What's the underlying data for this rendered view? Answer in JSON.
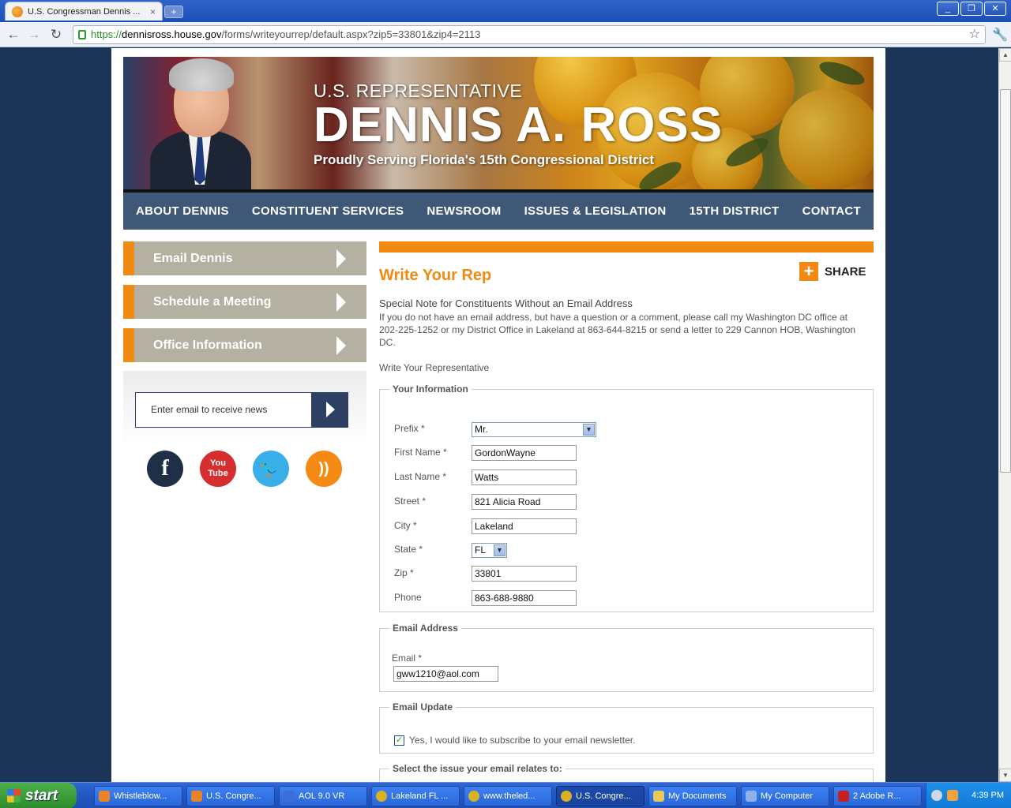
{
  "browser": {
    "tab_title": "U.S. Congressman Dennis ...",
    "tab_close": "×",
    "new_tab": "+",
    "url_scheme": "https://",
    "url_host": "dennisross.house.gov",
    "url_path": "/forms/writeyourrep/default.aspx?zip5=33801&zip4=2113"
  },
  "banner": {
    "pre_title": "U.S. REPRESENTATIVE",
    "name": "DENNIS A. ROSS",
    "subtitle": "Proudly Serving Florida's 15th Congressional District"
  },
  "nav": {
    "items": [
      "ABOUT DENNIS",
      "CONSTITUENT SERVICES",
      "NEWSROOM",
      "ISSUES & LEGISLATION",
      "15TH DISTRICT",
      "CONTACT"
    ]
  },
  "sidebar": {
    "buttons": [
      "Email Dennis",
      "Schedule a Meeting",
      "Office Information"
    ],
    "news_placeholder": "Enter email to receive news",
    "social": [
      {
        "name": "facebook-icon",
        "glyph": "f",
        "color": "#1f2f47"
      },
      {
        "name": "youtube-icon",
        "glyph": "You Tube",
        "color": "#d62e2e"
      },
      {
        "name": "twitter-icon",
        "glyph": "t",
        "color": "#3aaee8"
      },
      {
        "name": "rss-icon",
        "glyph": "))",
        "color": "#f58a14"
      }
    ]
  },
  "main": {
    "heading": "Write Your Rep",
    "share_label": "SHARE",
    "note_title": "Special Note for Constituents Without an Email Address",
    "note_body": "If you do not have an email address, but have a question or a comment, please call my Washington DC office at 202-225-1252 or my District Office in Lakeland at 863-644-8215 or send a letter to 229 Cannon HOB, Washington DC.",
    "write_label": "Write Your Representative",
    "your_info": {
      "legend": "Your Information",
      "prefix_label": "Prefix *",
      "prefix_value": "Mr.",
      "first_label": "First Name *",
      "first_value": "GordonWayne",
      "last_label": "Last Name *",
      "last_value": "Watts",
      "street_label": "Street *",
      "street_value": "821 Alicia Road",
      "city_label": "City *",
      "city_value": "Lakeland",
      "state_label": "State *",
      "state_value": "FL",
      "zip_label": "Zip *",
      "zip_value": "33801",
      "phone_label": "Phone",
      "phone_value": "863-688-9880"
    },
    "email": {
      "legend": "Email Address",
      "label": "Email *",
      "value": "gww1210@aol.com"
    },
    "update": {
      "legend": "Email Update",
      "checkbox_label": "Yes, I would like to subscribe to your email newsletter.",
      "checked": true
    },
    "issue_legend": "Select the issue your email relates to:"
  },
  "taskbar": {
    "start": "start",
    "tasks": [
      {
        "label": "Whistleblow...",
        "color": "#e8832a"
      },
      {
        "label": "U.S. Congre...",
        "color": "#e8832a"
      },
      {
        "label": "AOL 9.0 VR",
        "color": "#3a6fd8"
      },
      {
        "label": "Lakeland FL ...",
        "color": "#d9b224"
      },
      {
        "label": "www.theled...",
        "color": "#d9b224"
      },
      {
        "label": "U.S. Congre...",
        "color": "#d9b224"
      },
      {
        "label": "My Documents",
        "color": "#e8c95a"
      },
      {
        "label": "My Computer",
        "color": "#8fb2e8"
      },
      {
        "label": "2 Adobe R...",
        "color": "#c82020"
      }
    ],
    "clock": "4:39 PM"
  }
}
